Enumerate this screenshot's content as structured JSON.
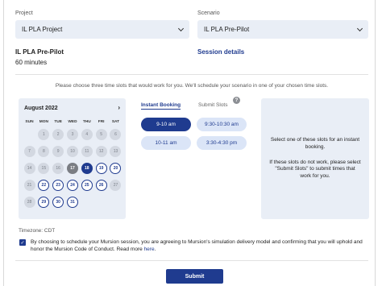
{
  "project": {
    "label": "Project",
    "value": "IL PLA Project"
  },
  "scenario": {
    "label": "Scenario",
    "value": "IL PLA Pre-Pilot"
  },
  "simulation": {
    "title": "IL PLA Pre-Pilot",
    "duration": "60 minutes",
    "details_link": "Session details"
  },
  "instructions": "Please choose three time slots that would work for you. We'll schedule your scenario in one of your chosen time slots.",
  "calendar": {
    "month": "August 2022",
    "next_icon": "chevron-right-icon",
    "days_of_week": [
      "SUN",
      "MON",
      "TUE",
      "WED",
      "THU",
      "FRI",
      "SAT"
    ],
    "weeks": [
      [
        {
          "d": ""
        },
        {
          "d": "1",
          "s": "disabled"
        },
        {
          "d": "2",
          "s": "disabled"
        },
        {
          "d": "3",
          "s": "disabled"
        },
        {
          "d": "4",
          "s": "disabled"
        },
        {
          "d": "5",
          "s": "disabled"
        },
        {
          "d": "6",
          "s": "disabled"
        }
      ],
      [
        {
          "d": "7",
          "s": "disabled"
        },
        {
          "d": "8",
          "s": "disabled"
        },
        {
          "d": "9",
          "s": "disabled"
        },
        {
          "d": "10",
          "s": "disabled"
        },
        {
          "d": "11",
          "s": "disabled"
        },
        {
          "d": "12",
          "s": "disabled"
        },
        {
          "d": "13",
          "s": "disabled"
        }
      ],
      [
        {
          "d": "14",
          "s": "disabled"
        },
        {
          "d": "15",
          "s": "disabled"
        },
        {
          "d": "16",
          "s": "disabled"
        },
        {
          "d": "17",
          "s": "today"
        },
        {
          "d": "18",
          "s": "selected"
        },
        {
          "d": "19",
          "s": "avail"
        },
        {
          "d": "20",
          "s": "avail"
        }
      ],
      [
        {
          "d": "21",
          "s": "disabled"
        },
        {
          "d": "22",
          "s": "avail"
        },
        {
          "d": "23",
          "s": "avail"
        },
        {
          "d": "24",
          "s": "avail"
        },
        {
          "d": "25",
          "s": "avail"
        },
        {
          "d": "26",
          "s": "avail"
        },
        {
          "d": "27",
          "s": "disabled"
        }
      ],
      [
        {
          "d": "28",
          "s": "disabled"
        },
        {
          "d": "29",
          "s": "avail"
        },
        {
          "d": "30",
          "s": "avail"
        },
        {
          "d": "31",
          "s": "avail"
        },
        {
          "d": ""
        },
        {
          "d": ""
        },
        {
          "d": ""
        }
      ]
    ]
  },
  "tabs": {
    "instant": "Instant Booking",
    "submit": "Submit Slots",
    "submit_badge": "?"
  },
  "slots": [
    "9-10 am",
    "9:30-10:30 am",
    "10-11 am",
    "3:30-4:30 pm"
  ],
  "info": {
    "line1": "Select one of these slots for an instant booking.",
    "line2": "If these slots do not work, please select \"Submit Slots\" to submit times that work for you."
  },
  "timezone": "Timezone: CDT",
  "consent": {
    "text": "By choosing to schedule your Mursion session, you are agreeing to Mursion's simulation delivery model and confirming that you will uphold and honor the Mursion Code of Conduct. Read more ",
    "link": "here",
    "end": "."
  },
  "submit_label": "Submit",
  "colors": {
    "accent": "#1f3b8f",
    "panel": "#e9eef6"
  }
}
